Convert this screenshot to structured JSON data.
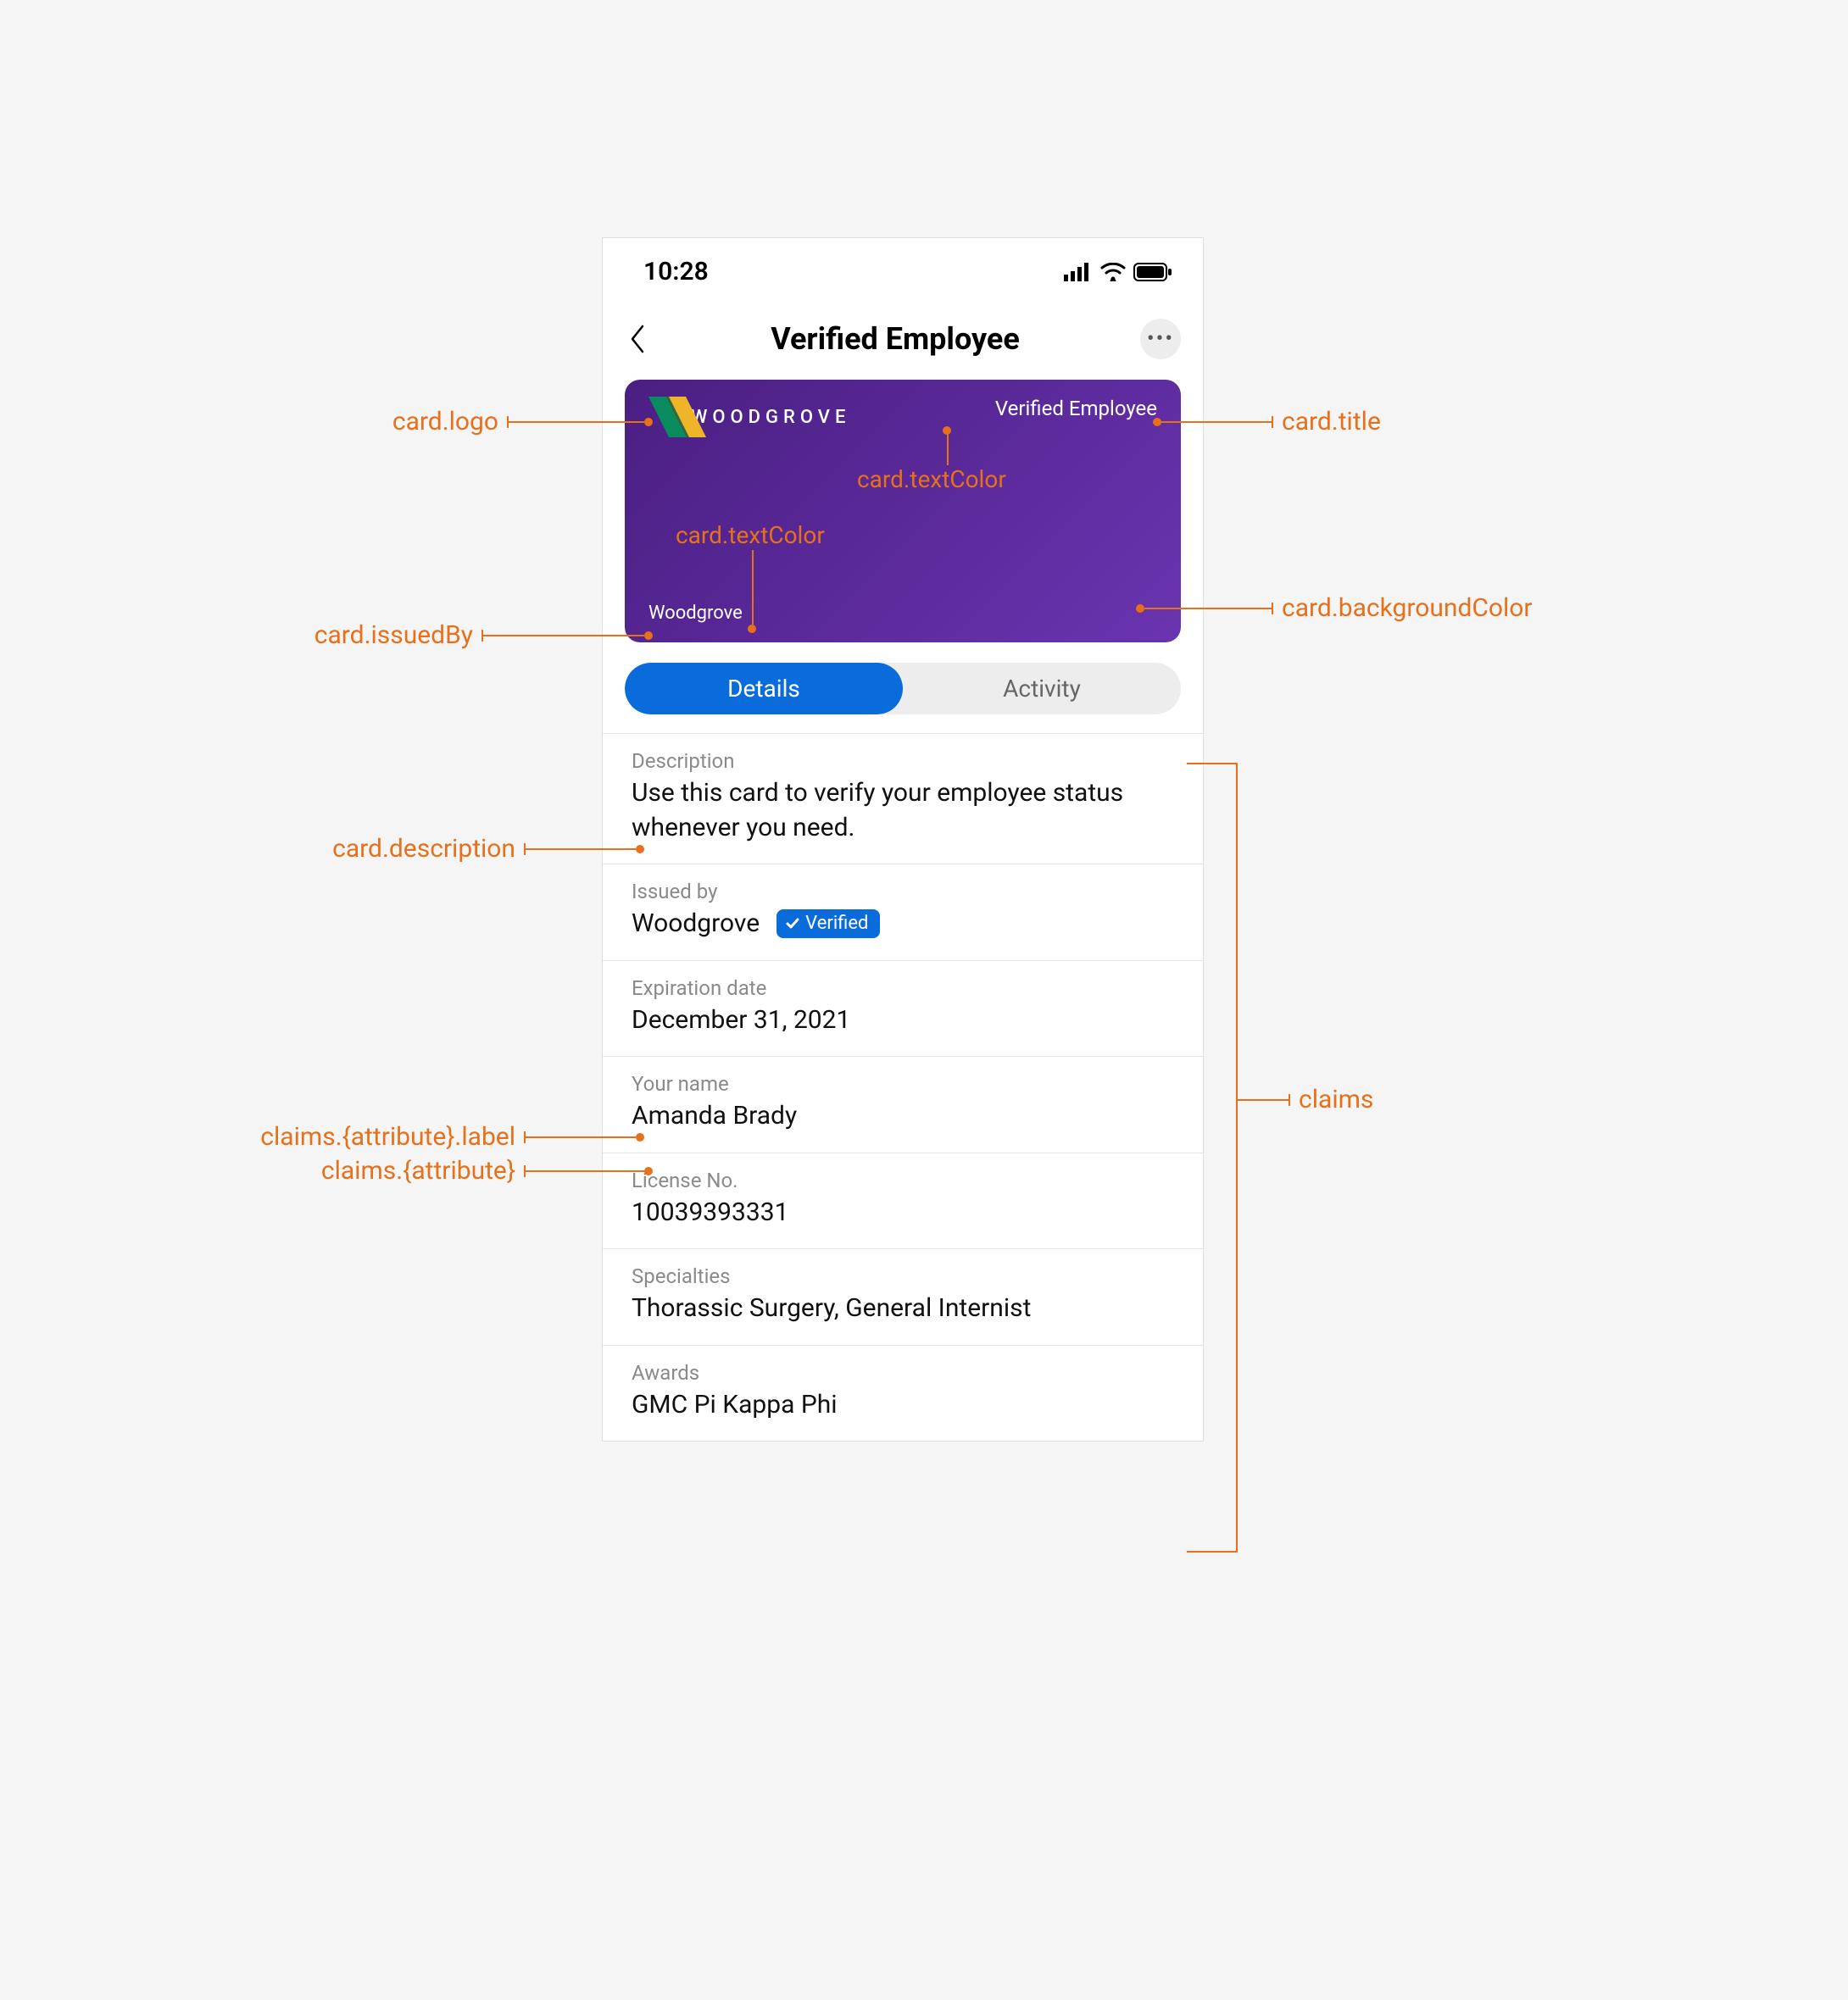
{
  "status": {
    "time": "10:28"
  },
  "nav": {
    "title": "Verified Employee"
  },
  "card": {
    "logoText": "WOODGROVE",
    "title": "Verified Employee",
    "issuer": "Woodgrove"
  },
  "tabs": {
    "details": "Details",
    "activity": "Activity"
  },
  "details": {
    "descriptionLabel": "Description",
    "descriptionValue": "Use this card to verify your employee status whenever you need.",
    "issuedByLabel": "Issued by",
    "issuedByValue": "Woodgrove",
    "verifiedBadge": "Verified",
    "expirationLabel": "Expiration date",
    "expirationValue": "December 31, 2021",
    "nameLabel": "Your name",
    "nameValue": "Amanda Brady",
    "licenseLabel": "License No.",
    "licenseValue": "10039393331",
    "specialtiesLabel": "Specialties",
    "specialtiesValue": "Thorassic Surgery, General Internist",
    "awardsLabel": "Awards",
    "awardsValue": "GMC Pi Kappa Phi"
  },
  "annotations": {
    "cardLogo": "card.logo",
    "cardTitle": "card.title",
    "cardTextColor1": "card.textColor",
    "cardTextColor2": "card.textColor",
    "cardBackgroundColor": "card.backgroundColor",
    "cardIssuedBy": "card.issuedBy",
    "cardDescription": "card.description",
    "claims": "claims",
    "claimsAttrLabel": "claims.{attribute}.label",
    "claimsAttr": "claims.{attribute}"
  }
}
